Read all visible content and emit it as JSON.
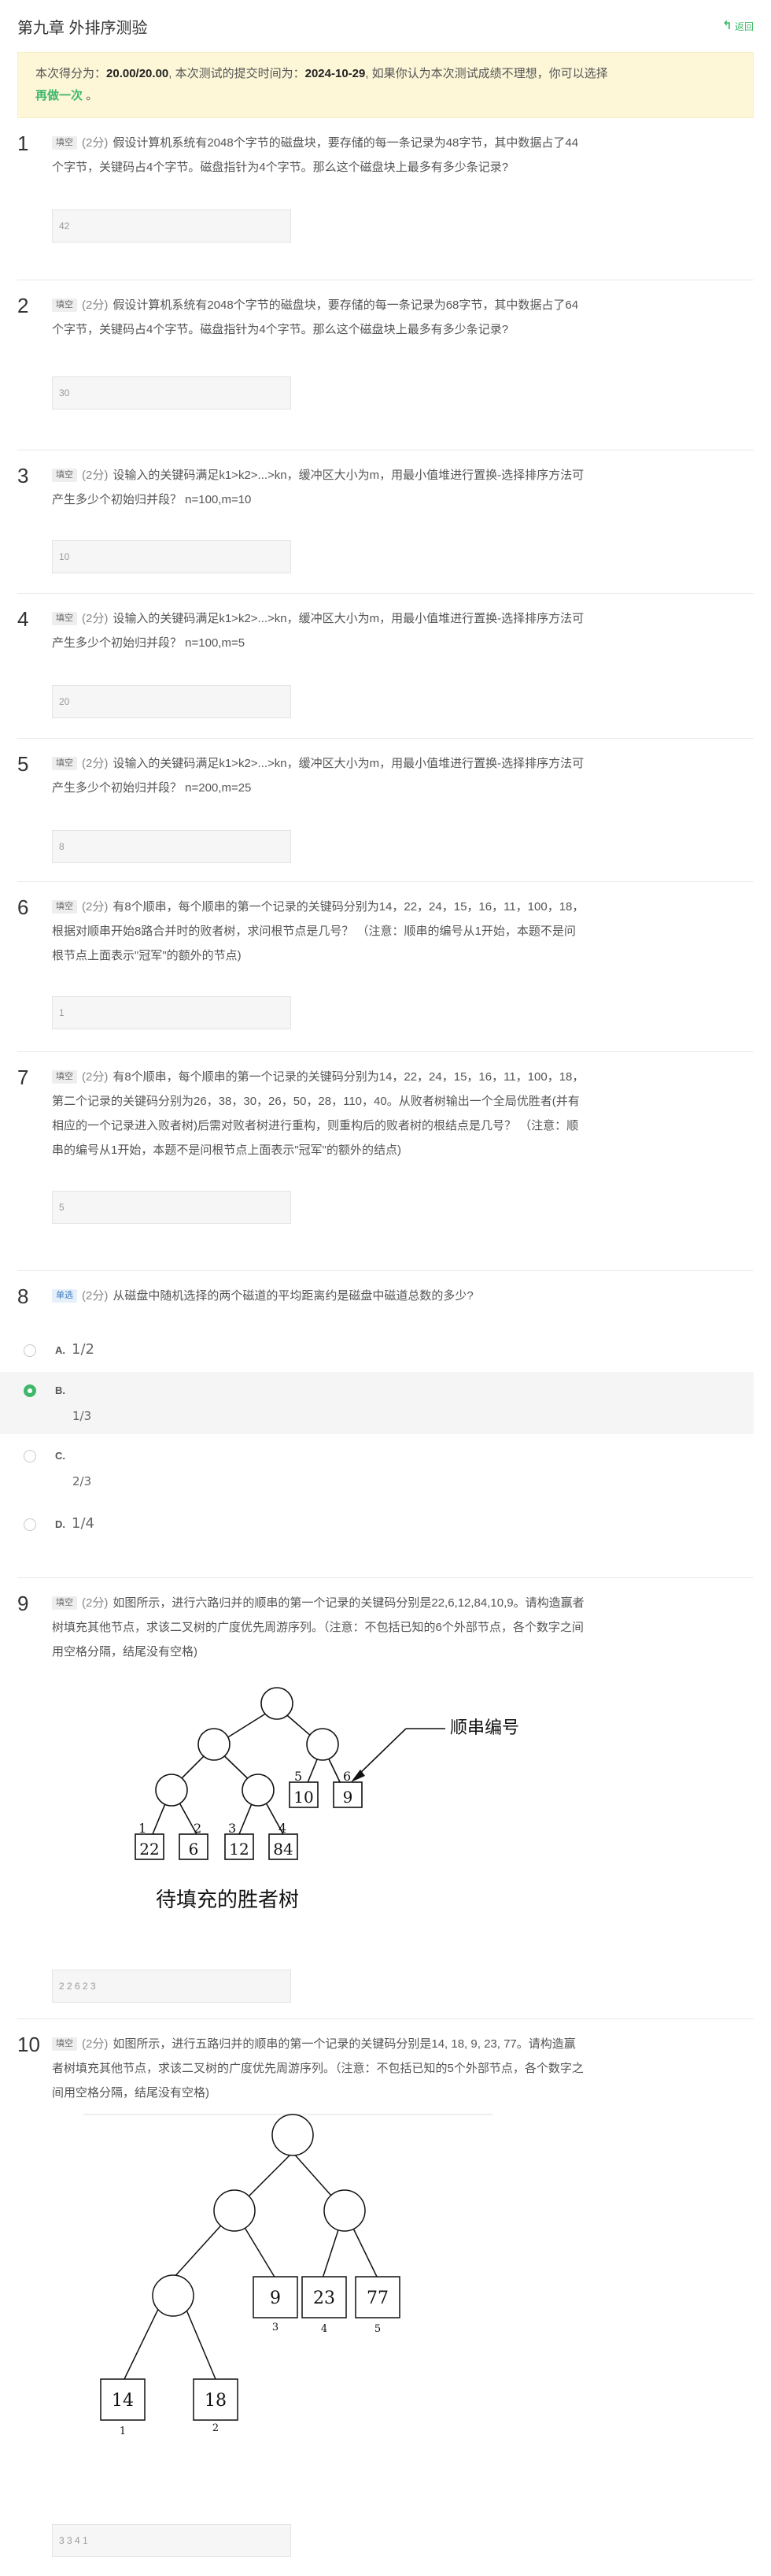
{
  "header": {
    "title": "第九章 外排序测验",
    "back_label": "返回"
  },
  "notice": {
    "score_prefix": "本次得分为：",
    "score": "20.00/20.00",
    "time_prefix": ", 本次测试的提交时间为：",
    "submit_time": "2024-10-29",
    "suffix": ", 如果你认为本次测试成绩不理想，你可以选择",
    "redo_label": "再做一次",
    "end": "。"
  },
  "questions": [
    {
      "num": "1",
      "tag": "填空",
      "points": "(2分)",
      "text": "假设计算机系统有2048个字节的磁盘块，要存储的每一条记录为48字节，其中数据占了44个字节，关键码占4个字节。磁盘指针为4个字节。那么这个磁盘块上最多有多少条记录?",
      "answer": "42"
    },
    {
      "num": "2",
      "tag": "填空",
      "points": "(2分)",
      "text": "假设计算机系统有2048个字节的磁盘块，要存储的每一条记录为68字节，其中数据占了64个字节，关键码占4个字节。磁盘指针为4个字节。那么这个磁盘块上最多有多少条记录?",
      "answer": "30"
    },
    {
      "num": "3",
      "tag": "填空",
      "points": "(2分)",
      "text": "设输入的关键码满足k1>k2>...>kn，缓冲区大小为m，用最小值堆进行置换-选择排序方法可产生多少个初始归并段？ n=100,m=10",
      "answer": "10"
    },
    {
      "num": "4",
      "tag": "填空",
      "points": "(2分)",
      "text": "设输入的关键码满足k1>k2>...>kn，缓冲区大小为m，用最小值堆进行置换-选择排序方法可产生多少个初始归并段？ n=100,m=5",
      "answer": "20"
    },
    {
      "num": "5",
      "tag": "填空",
      "points": "(2分)",
      "text": "设输入的关键码满足k1>k2>...>kn，缓冲区大小为m，用最小值堆进行置换-选择排序方法可产生多少个初始归并段？ n=200,m=25",
      "answer": "8"
    },
    {
      "num": "6",
      "tag": "填空",
      "points": "(2分)",
      "text": "有8个顺串，每个顺串的第一个记录的关键码分别为14，22，24，15，16，11，100，18，根据对顺串开始8路合并时的败者树，求问根节点是几号？ （注意：顺串的编号从1开始，本题不是问根节点上面表示\"冠军\"的额外的节点)",
      "answer": "1"
    },
    {
      "num": "7",
      "tag": "填空",
      "points": "(2分)",
      "text": "有8个顺串，每个顺串的第一个记录的关键码分别为14，22，24，15，16，11，100，18，第二个记录的关键码分别为26，38，30，26，50，28，110，40。从败者树输出一个全局优胜者(并有相应的一个记录进入败者树)后需对败者树进行重构，则重构后的败者树的根结点是几号？ （注意：顺串的编号从1开始，本题不是问根节点上面表示\"冠军\"的额外的结点)",
      "answer": "5"
    },
    {
      "num": "8",
      "tag": "单选",
      "points": "(2分)",
      "text": "从磁盘中随机选择的两个磁道的平均距离约是磁盘中磁道总数的多少?",
      "options": [
        {
          "letter": "A.",
          "text": "1/2",
          "selected": false
        },
        {
          "letter": "B.",
          "text": "1/3",
          "selected": true
        },
        {
          "letter": "C.",
          "text": "2/3",
          "selected": false
        },
        {
          "letter": "D.",
          "text": "1/4",
          "selected": false
        }
      ]
    },
    {
      "num": "9",
      "tag": "填空",
      "points": "(2分)",
      "text": "如图所示，进行六路归并的顺串的第一个记录的关键码分别是22,6,12,84,10,9。请构造赢者树填充其他节点，求该二叉树的广度优先周游序列。（注意：不包括已知的6个外部节点，各个数字之间用空格分隔，结尾没有空格)",
      "answer": "2 2 6 2 3",
      "figure": {
        "caption": "待填充的胜者树",
        "pointer_label": "顺串编号",
        "leaves": [
          {
            "label": "1",
            "value": "22"
          },
          {
            "label": "2",
            "value": "6"
          },
          {
            "label": "3",
            "value": "12"
          },
          {
            "label": "4",
            "value": "84"
          },
          {
            "label": "5",
            "value": "10"
          },
          {
            "label": "6",
            "value": "9"
          }
        ]
      }
    },
    {
      "num": "10",
      "tag": "填空",
      "points": "(2分)",
      "text": "如图所示，进行五路归并的顺串的第一个记录的关键码分别是14, 18, 9, 23, 77。请构造赢者树填充其他节点，求该二叉树的广度优先周游序列。（注意：不包括已知的5个外部节点，各个数字之间用空格分隔，结尾没有空格)",
      "answer": "3 3 4 1",
      "figure": {
        "leaves": [
          {
            "label": "1",
            "value": "14"
          },
          {
            "label": "2",
            "value": "18"
          },
          {
            "label": "3",
            "value": "9"
          },
          {
            "label": "4",
            "value": "23"
          },
          {
            "label": "5",
            "value": "77"
          }
        ]
      }
    }
  ],
  "colors": {
    "accent": "#3fb86a",
    "notice_bg": "#fdf7d8"
  }
}
